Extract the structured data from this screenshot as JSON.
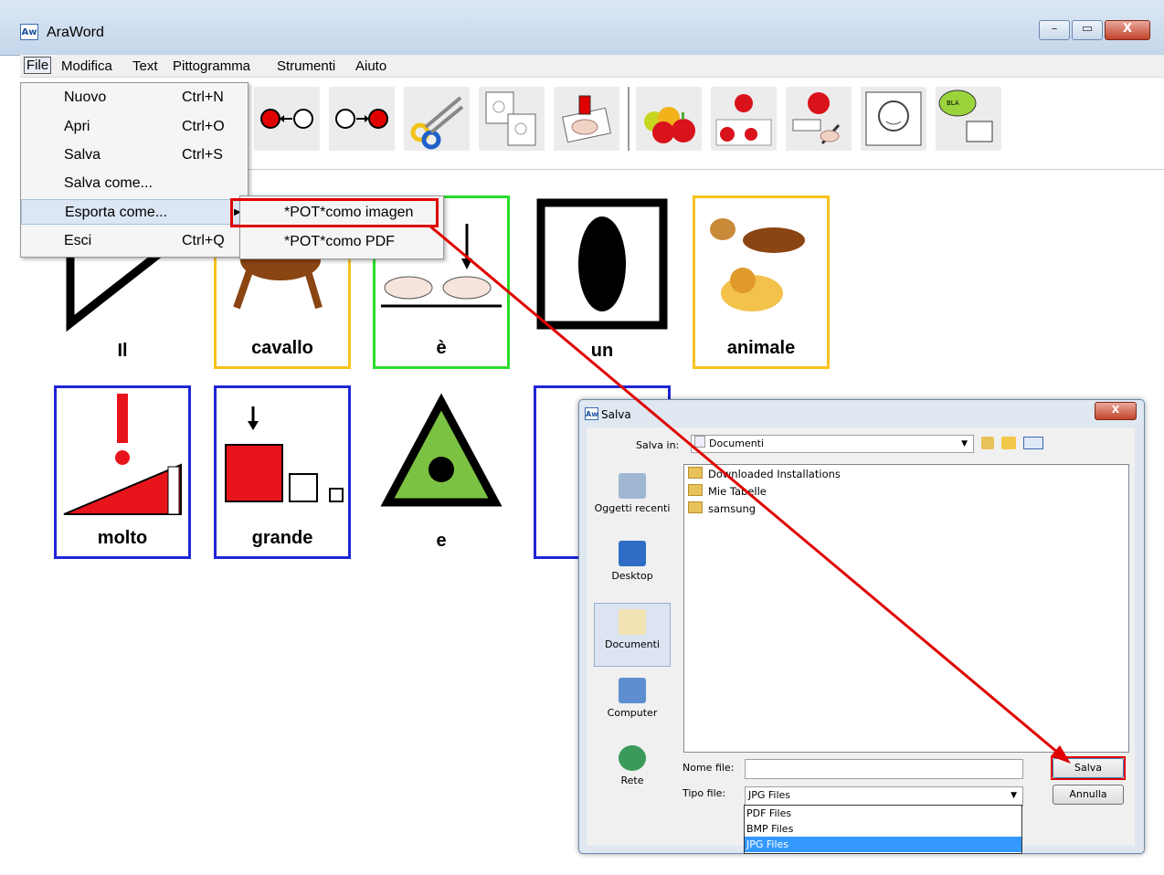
{
  "window": {
    "app_icon_text": "Aw",
    "title": "AraWord",
    "min": "–",
    "max": "▭",
    "close": "X"
  },
  "menubar": {
    "items": [
      "File",
      "Modifica",
      "Text",
      "Pittogramma",
      "Strumenti",
      "Aiuto"
    ]
  },
  "file_menu": [
    {
      "label": "Nuovo",
      "shortcut": "Ctrl+N"
    },
    {
      "label": "Apri",
      "shortcut": "Ctrl+O"
    },
    {
      "label": "Salva",
      "shortcut": "Ctrl+S"
    },
    {
      "label": "Salva come...",
      "shortcut": ""
    },
    {
      "label": "Esporta come...",
      "shortcut": ""
    },
    {
      "label": "Esci",
      "shortcut": "Ctrl+Q"
    }
  ],
  "export_submenu": [
    "*POT*como imagen",
    "*POT*como PDF"
  ],
  "pictograms_row1": [
    "Il",
    "cavallo",
    "è",
    "un",
    "animale"
  ],
  "pictograms_row2": [
    "molto",
    "grande",
    "e"
  ],
  "colors": {
    "accent_red": "#e00000",
    "card_yellow": "#f8c21c",
    "card_green": "#2bdc2b",
    "card_blue": "#1f25d6",
    "highlight": "#3399ff"
  },
  "save_dialog": {
    "icon_text": "Aw",
    "title": "Salva",
    "close": "X",
    "save_in_label": "Salva in:",
    "save_in_value": "Documenti",
    "places": [
      "Oggetti recenti",
      "Desktop",
      "Documenti",
      "Computer",
      "Rete"
    ],
    "files": [
      "Downloaded Installations",
      "Mie Tabelle",
      "samsung"
    ],
    "filename_label": "Nome file:",
    "filename_value": "",
    "filetype_label": "Tipo file:",
    "filetype_value": "JPG Files",
    "filetype_options": [
      "PDF Files",
      "BMP Files",
      "JPG Files"
    ],
    "save_button": "Salva",
    "cancel_button": "Annulla"
  }
}
